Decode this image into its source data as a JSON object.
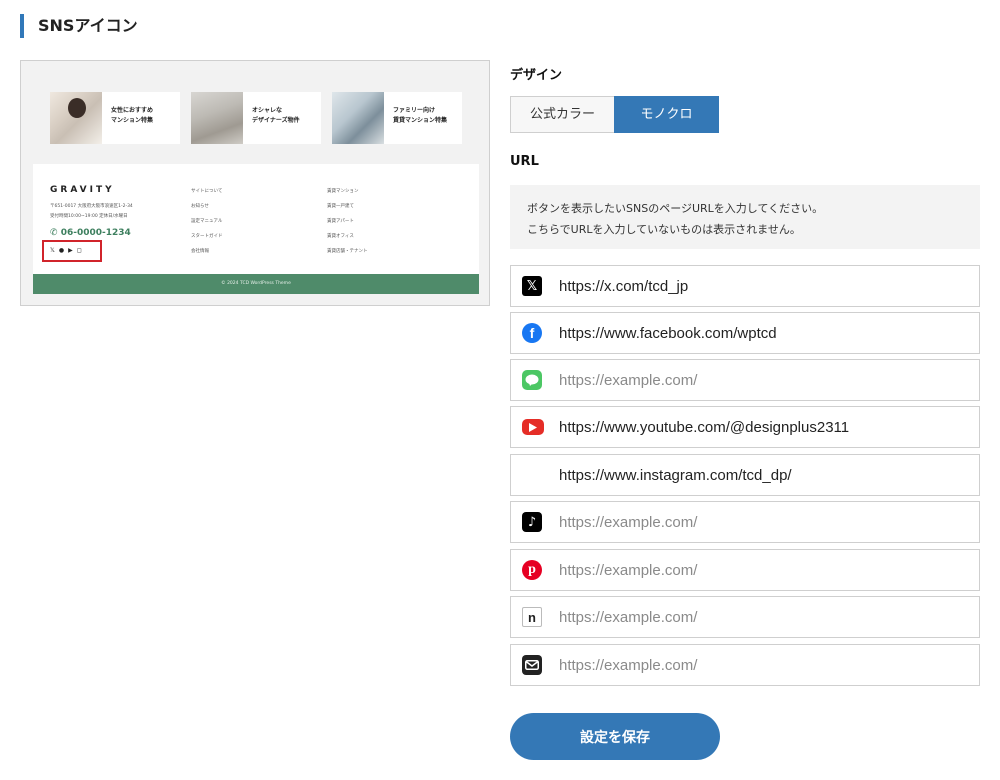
{
  "section": {
    "title": "SNSアイコン"
  },
  "preview": {
    "banners": [
      {
        "text": "女性におすすめ\nマンション特集"
      },
      {
        "text": "オシャレな\nデザイナーズ物件"
      },
      {
        "text": "ファミリー向け\n賃貸マンション特集"
      }
    ],
    "logo": "GRAVITY",
    "address": "〒651-0017 大阪府大阪市浪速区1-2-34\n受付時間10:00~19:00 定休日/水曜日",
    "phone": "06-0000-1234",
    "nav_col1": [
      "サイトについて",
      "お知らせ",
      "設定マニュアル",
      "スタートガイド",
      "会社情報"
    ],
    "nav_col2": [
      "賃貸マンション",
      "賃貸一戸建て",
      "賃貸アパート",
      "賃貸オフィス",
      "賃貸店舗・テナント"
    ],
    "copyright": "© 2024 TCD WordPress Theme"
  },
  "design": {
    "label": "デザイン",
    "options": [
      "公式カラー",
      "モノクロ"
    ],
    "selected": "モノクロ"
  },
  "url_section": {
    "label": "URL",
    "note_line1": "ボタンを表示したいSNSのページURLを入力してください。",
    "note_line2": "こちらでURLを入力していないものは表示されません。"
  },
  "sns_fields": [
    {
      "icon": "x-icon",
      "value": "https://x.com/tcd_jp",
      "placeholder": "https://example.com/"
    },
    {
      "icon": "facebook-icon",
      "value": "https://www.facebook.com/wptcd",
      "placeholder": "https://example.com/"
    },
    {
      "icon": "line-icon",
      "value": "",
      "placeholder": "https://example.com/"
    },
    {
      "icon": "youtube-icon",
      "value": "https://www.youtube.com/@designplus2311",
      "placeholder": "https://example.com/"
    },
    {
      "icon": "instagram-icon",
      "value": "https://www.instagram.com/tcd_dp/",
      "placeholder": "https://example.com/"
    },
    {
      "icon": "tiktok-icon",
      "value": "",
      "placeholder": "https://example.com/"
    },
    {
      "icon": "pinterest-icon",
      "value": "",
      "placeholder": "https://example.com/"
    },
    {
      "icon": "note-icon",
      "value": "",
      "placeholder": "https://example.com/"
    },
    {
      "icon": "mail-icon",
      "value": "",
      "placeholder": "https://example.com/"
    }
  ],
  "save_label": "設定を保存",
  "colors": {
    "accent": "#3478b6",
    "footer_green": "#4f8b6a",
    "highlight_red": "#d1242b"
  }
}
